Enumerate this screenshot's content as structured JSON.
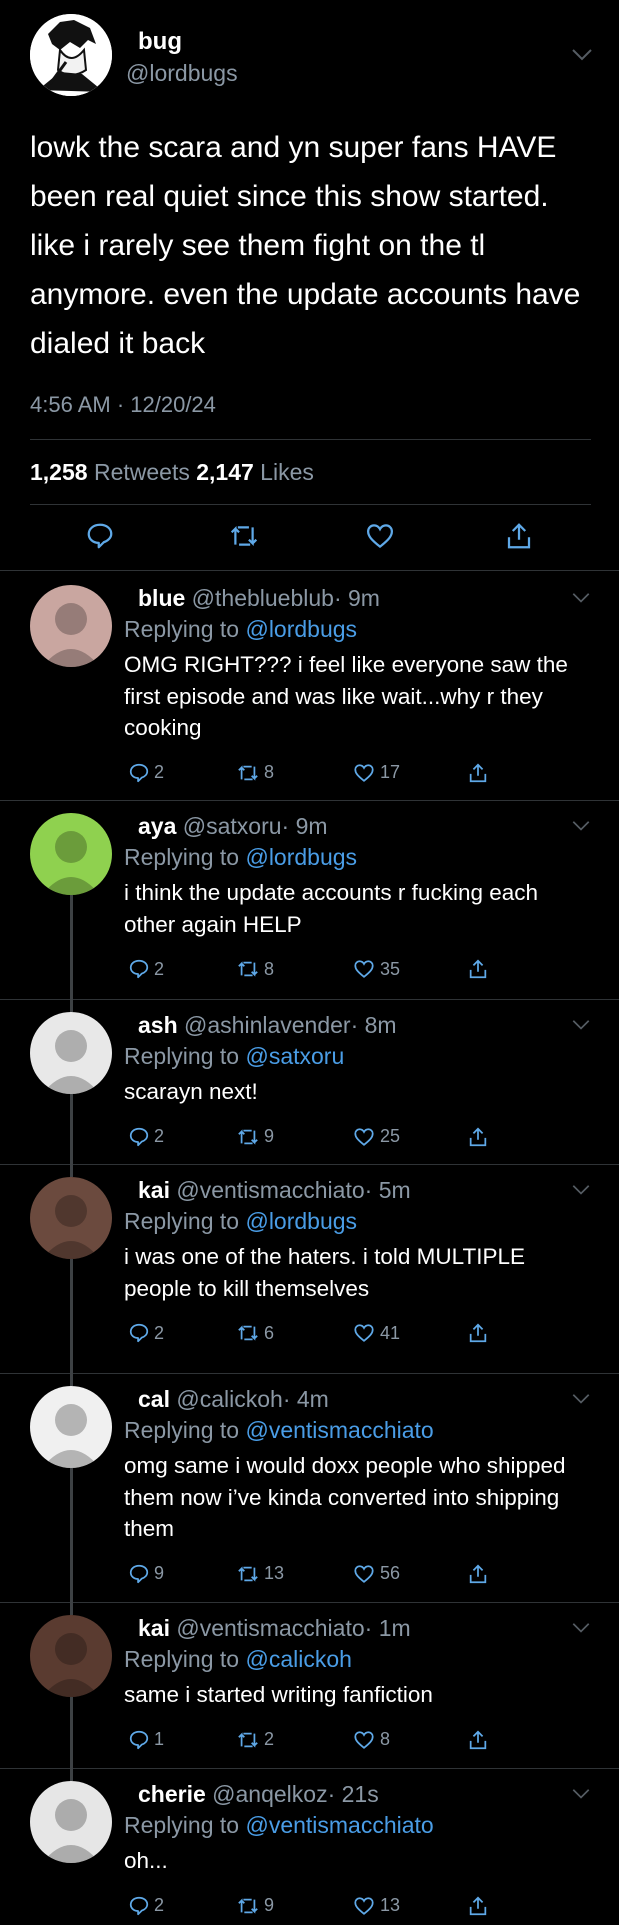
{
  "tweet": {
    "name": "bug",
    "handle": "@lordbugs",
    "text": "lowk the scara and yn super fans HAVE been real quiet since this show started. like i rarely see them fight on the tl anymore. even the update accounts have dialed it back",
    "timestamp": "4:56 AM · 12/20/24",
    "retweets_count": "1,258",
    "retweets_label": "Retweets",
    "likes_count": "2,147",
    "likes_label": "Likes"
  },
  "replies": [
    {
      "name": "blue",
      "handle": "@theblueblub",
      "time": "· 9m",
      "replying_prefix": "Replying to",
      "replying_to": "@lordbugs",
      "text": "OMG RIGHT??? i feel like everyone saw the first episode and was like wait...why r they cooking",
      "replies": "2",
      "retweets": "8",
      "likes": "17",
      "avatar_color": "#c9a6a0"
    },
    {
      "name": "aya",
      "handle": "@satxoru",
      "time": "· 9m",
      "replying_prefix": "Replying to",
      "replying_to": "@lordbugs",
      "text": "i think the update accounts r fucking each other again HELP",
      "replies": "2",
      "retweets": "8",
      "likes": "35",
      "avatar_color": "#8fd14f"
    },
    {
      "name": "ash",
      "handle": "@ashinlavender",
      "time": "· 8m",
      "replying_prefix": "Replying to",
      "replying_to": "@satxoru",
      "text": "scarayn next!",
      "replies": "2",
      "retweets": "9",
      "likes": "25",
      "avatar_color": "#e8e8e8"
    },
    {
      "name": "kai",
      "handle": "@ventismacchiato",
      "time": "· 5m",
      "replying_prefix": "Replying to",
      "replying_to": "@lordbugs",
      "text": "i was one of the haters. i told MULTIPLE people to kill themselves",
      "replies": "2",
      "retweets": "6",
      "likes": "41",
      "avatar_color": "#6b4a3e"
    },
    {
      "name": "cal",
      "handle": "@calickoh",
      "time": "· 4m",
      "replying_prefix": "Replying to",
      "replying_to": "@ventismacchiato",
      "text": "omg same i would doxx people who shipped them now i’ve kinda converted into shipping them",
      "replies": "9",
      "retweets": "13",
      "likes": "56",
      "avatar_color": "#f0f0f0"
    },
    {
      "name": "kai",
      "handle": "@ventismacchiato",
      "time": "· 1m",
      "replying_prefix": "Replying to",
      "replying_to": "@calickoh",
      "text": "same i started writing fanfiction",
      "replies": "1",
      "retweets": "2",
      "likes": "8",
      "avatar_color": "#5a3b30"
    },
    {
      "name": "cherie",
      "handle": "@anqelkoz",
      "time": "· 21s",
      "replying_prefix": "Replying to",
      "replying_to": "@ventismacchiato",
      "text": "oh...",
      "replies": "2",
      "retweets": "9",
      "likes": "13",
      "avatar_color": "#e6e6e6"
    }
  ],
  "icons": {
    "reply": "reply-icon",
    "retweet": "retweet-icon",
    "like": "heart-icon",
    "share": "share-icon",
    "more": "chevron-down-icon"
  }
}
